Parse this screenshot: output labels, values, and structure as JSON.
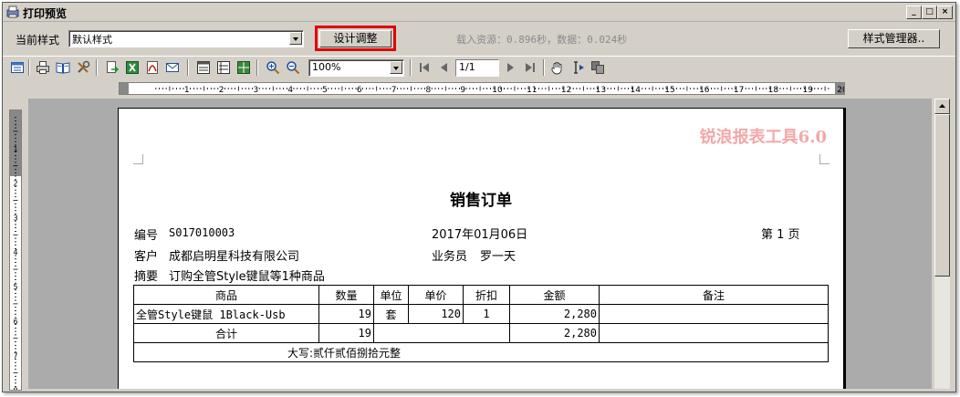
{
  "window": {
    "title": "打印预览"
  },
  "top": {
    "style_label": "当前样式",
    "style_value": "默认样式",
    "design_button": "设计调整",
    "status_text": "载入资源：0.896秒，数据：0.024秒",
    "manager_button": "样式管理器.."
  },
  "toolbar": {
    "zoom_value": "100%",
    "page_value": "1/1",
    "icons": [
      "view-icon",
      "print-icon",
      "book-icon",
      "tools-icon",
      "export-icon",
      "excel-icon",
      "pdf-icon",
      "email-icon",
      "layout1-icon",
      "layout2-icon",
      "layout3-icon",
      "zoom-in-icon",
      "zoom-out-icon",
      "first-page-icon",
      "prev-page-icon",
      "next-page-icon",
      "last-page-icon",
      "hand-icon",
      "select-text-icon",
      "copy-icon"
    ]
  },
  "ruler": {
    "h_numbers": [
      "1",
      "2",
      "3",
      "4",
      "5",
      "6",
      "7",
      "8",
      "9",
      "10",
      "11",
      "12",
      "13",
      "14",
      "15",
      "16",
      "17",
      "18",
      "19",
      "20"
    ]
  },
  "report": {
    "watermark": "锐浪报表工具6.0",
    "title": "销售订单",
    "order_no_label": "编号",
    "order_no": "S017010003",
    "date": "2017年01月06日",
    "page_label": "第 1 页",
    "customer_label": "客户",
    "customer": "成都启明星科技有限公司",
    "salesperson_label": "业务员",
    "salesperson": "罗一天",
    "summary_label": "摘要",
    "summary": "订购全管Style键鼠等1种商品",
    "headers": [
      "商品",
      "数量",
      "单位",
      "单价",
      "折扣",
      "金额",
      "备注"
    ],
    "row": {
      "product": "全管Style键鼠 1Black-Usb",
      "qty": "19",
      "unit": "套",
      "price": "120",
      "discount": "1",
      "amount": "2,280",
      "note": ""
    },
    "total_label": "合计",
    "total_qty": "19",
    "total_amount": "2,280",
    "capital": "大写:贰仟贰佰捌拾元整"
  }
}
